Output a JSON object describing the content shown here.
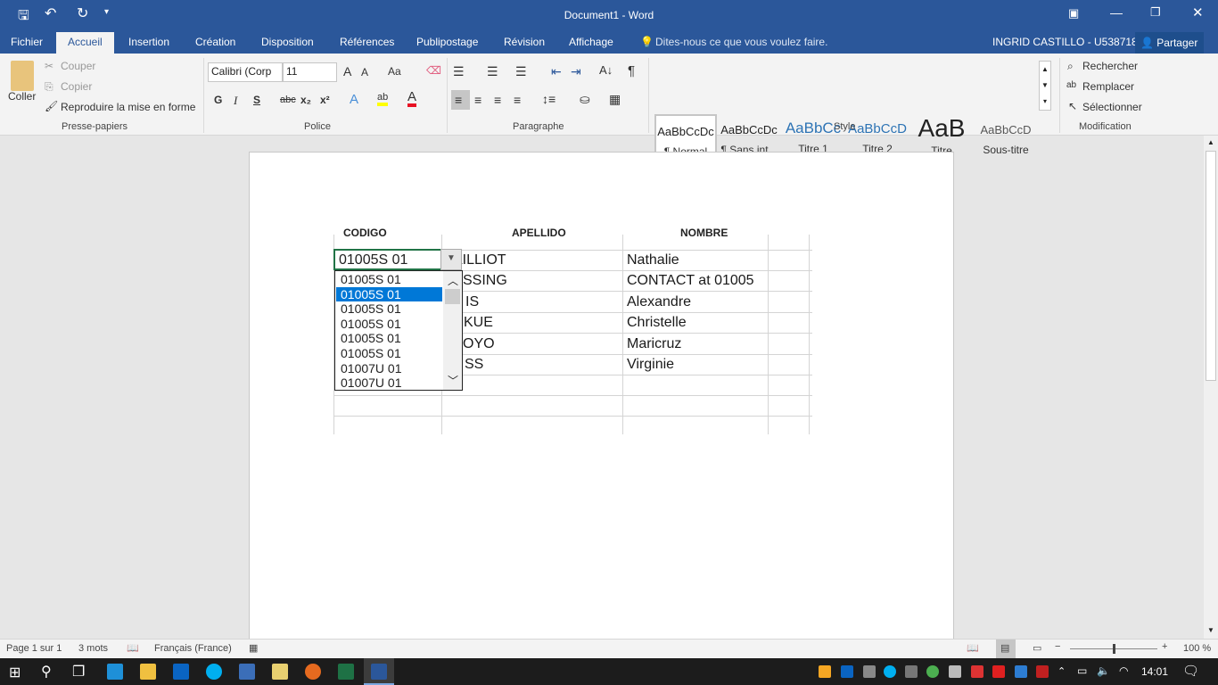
{
  "titlebar": {
    "title": "Document1 - Word",
    "qat": [
      "save-icon",
      "undo-icon",
      "redo-icon",
      "customize-icon"
    ]
  },
  "tabs": [
    "Fichier",
    "Accueil",
    "Insertion",
    "Création",
    "Disposition",
    "Références",
    "Publipostage",
    "Révision",
    "Affichage"
  ],
  "active_tab": "Accueil",
  "tell_me": "Dites-nous ce que vous voulez faire.",
  "user": "INGRID CASTILLO - U538718",
  "share": "Partager",
  "ribbon": {
    "clipboard": {
      "paste": "Coller",
      "cut": "Couper",
      "copy": "Copier",
      "format_painter": "Reproduire la mise en forme",
      "label": "Presse-papiers"
    },
    "font": {
      "name": "Calibri (Corp",
      "size": "11",
      "label": "Police",
      "bold": "G",
      "italic": "I",
      "underline": "S",
      "strike": "abc",
      "sub": "x₂",
      "sup": "x²",
      "case": "Aa",
      "highlight_color": "#ffff00",
      "font_color": "#e81123"
    },
    "paragraph": {
      "label": "Paragraphe"
    },
    "styles": {
      "label": "Style",
      "items": [
        {
          "preview": "AaBbCcDc",
          "name": "¶ Normal"
        },
        {
          "preview": "AaBbCcDc",
          "name": "¶ Sans int..."
        },
        {
          "preview": "AaBbCc",
          "name": "Titre 1"
        },
        {
          "preview": "AaBbCcD",
          "name": "Titre 2"
        },
        {
          "preview": "AaB",
          "name": "Titre"
        },
        {
          "preview": "AaBbCcD",
          "name": "Sous-titre"
        }
      ]
    },
    "editing": {
      "label": "Modification",
      "find": "Rechercher",
      "replace": "Remplacer",
      "select": "Sélectionner"
    }
  },
  "table": {
    "headers": [
      "CODIGO",
      "APELLIDO",
      "NOMBRE"
    ],
    "combo_value": "01005S  01",
    "rows": [
      [
        "AILLIOT",
        "Nathalie"
      ],
      [
        "SSING",
        "CONTACT at 01005"
      ],
      [
        "IS",
        "Alexandre"
      ],
      [
        "KUE",
        "Christelle"
      ],
      [
        "OYO",
        "Maricruz"
      ],
      [
        "SS",
        "Virginie"
      ]
    ],
    "dropdown": {
      "items": [
        "01005S  01",
        "01005S  01",
        "01005S  01",
        "01005S  01",
        "01005S  01",
        "01005S  01",
        "01007U  01",
        "01007U  01"
      ],
      "selected_index": 1
    }
  },
  "status": {
    "page": "Page 1 sur 1",
    "words": "3 mots",
    "language": "Français (France)",
    "zoom": "100 %",
    "zoom_percent": 100
  },
  "taskbar": {
    "time": "14:01"
  }
}
